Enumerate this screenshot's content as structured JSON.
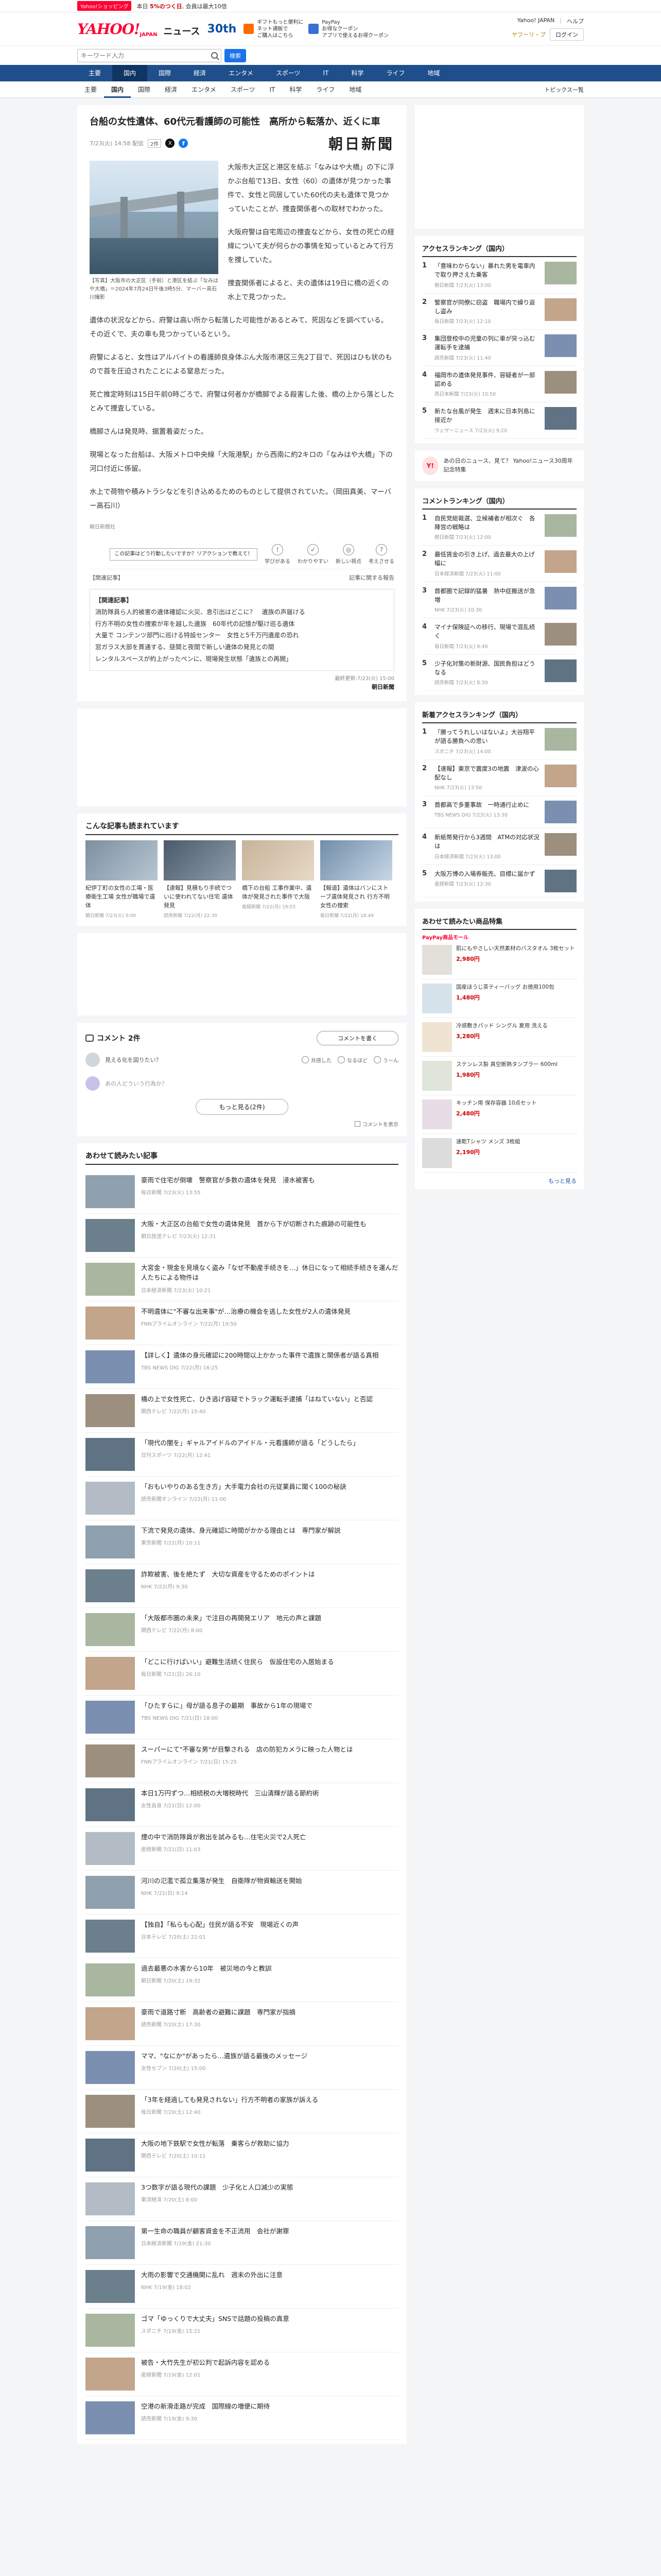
{
  "promo": {
    "badge": "Yahoo!ショッピング",
    "text": "本日 ",
    "text_strong": "5%のつく日",
    "text_tail": ", 会員は最大10倍"
  },
  "header": {
    "logo": "YAHOO!",
    "logo_sub": "JAPAN",
    "news": "ニュース",
    "anniv": "30th",
    "ads": [
      {
        "line1": "ギフトもっと便利に",
        "line2": "ネット通販で",
        "line3": "ご購入はこちら"
      },
      {
        "line1": "PayPay",
        "line2": "お得なクーポン",
        "line3": "アプリで使えるお得クーポン"
      }
    ],
    "links": [
      "Yahoo! JAPAN",
      "ヘルプ"
    ],
    "login": "ログイン",
    "premium": "ヤフーリ・プ"
  },
  "search": {
    "placeholder": "キーワード入力",
    "button": "検索"
  },
  "gnav": {
    "items": [
      "主要",
      "国内",
      "国際",
      "経済",
      "エンタメ",
      "スポーツ",
      "IT",
      "科学",
      "ライフ",
      "地域"
    ],
    "active_index": 1,
    "more": "トピックス一覧"
  },
  "snav": {
    "items": [
      "主要",
      "国内",
      "国際",
      "経済",
      "エンタメ",
      "スポーツ",
      "IT",
      "科学",
      "ライフ",
      "地域"
    ],
    "active_index": 1,
    "topics": "トピックス一覧"
  },
  "article": {
    "title": "台船の女性遺体、60代元看護師の可能性　高所から転落か、近くに車",
    "datetime": "7/23(火) 14:58 配信",
    "comments": "2件",
    "provider": "朝日新聞",
    "figure_caption": "【写真】大阪市の大正区（手前）と港区を結ぶ「なみはや大橋」＝2024年7月24日午後3時5分、マーバー高石川撮影",
    "p1": "大阪市大正区と港区を結ぶ「なみはや大橋」の下に浮かぶ台船で13日、女性（60）の遺体が見つかった事件で、女性と同居していた60代の夫も遺体で見つかっていたことが、捜査関係者への取材でわかった。",
    "p2": "大阪府警は自宅周辺の捜査などから、女性の死亡の経緯について夫が何らかの事情を知っているとみて行方を捜していた。",
    "p3": "捜査関係者によると、夫の遺体は19日に橋の近くの水上で見つかった。",
    "p4": "遺体の状況などから、府警は高い所から転落した可能性があるとみて、死因などを調べている。その近くで、夫の車も見つかっているという。",
    "p5": "府警によると、女性はアルバイトの看護師良身体ぶん大阪市港区三先2丁目で、死因はひも状のもので首を圧迫されたことによる窒息だった。",
    "p6": "死亡推定時刻は15日午前0時ごろで、府警は何者かが橋脚でよる殺害した後、橋の上から落としたとみて捜査している。",
    "p7": "橋脚さんは発見時、据置着姿だった。",
    "p8": "現場となった台船は、大阪メトロ中央線「大阪港駅」から西南に約2キロの「なみはや大橋」下の河口付近に係留。",
    "p9": "水上で荷物や積みトラシなどを引き込めるためのものとして提供されていた。（岡田真美、マーバー高石川）",
    "author": "朝日新聞社",
    "reaction_tip": "この記事はどう行動したいですか？リアクションで教えて！",
    "reactions": [
      "学びがある",
      "わかりやすい",
      "新しい視点",
      "考えさせる"
    ],
    "related_left": "【関連記事】",
    "related_right": "記事に関する報告"
  },
  "related_box": {
    "head": "【関連記事】",
    "lines": [
      "消防隊員ら人的被害の遺体確認に火災、息引出はどこに？　遺族の声届ける",
      "行方不明の女性の捜索が年を越した遺族　60年代の記憶が駆け巡る遺体",
      "大量で コンテンツ部門に巡ける特設センター　女性と5千万円遺産の恐れ",
      "窓ガラス大部を貫通する、昼間と夜間で新しい遺体の発見との間",
      "レンタルスペースが約上がったペンに、現場発生状態「遺族との再開」"
    ],
    "updated": "最終更新:7/23(火) 15:00",
    "source": "朝日新聞"
  },
  "recommend": {
    "title": "こんな記事も読まれています",
    "items": [
      {
        "text": "紀伊丁町の女性の工場・医療衛生工場 女性が職場で遺体",
        "src": "朝日新聞 7/23(火) 0:00"
      },
      {
        "text": "【速報】見積もり手続でついに使われてない住宅 遺体発見",
        "src": "読売新聞 7/22(月) 22:30"
      },
      {
        "text": "橋下の台船 工事作業中、遺体が発見された事件で大阪",
        "src": "産経新聞 7/22(月) 19:03"
      },
      {
        "text": "【報道】遺体はバンにストーブ遺体発見され 行方不明女性の捜索",
        "src": "毎日新聞 7/22(月) 18:49"
      }
    ]
  },
  "comments": {
    "title": "コメント 2件",
    "write": "コメントを書く",
    "row_text": "見える化を図りたい？",
    "actions": [
      "共感した",
      "なるほど",
      "うーん"
    ],
    "more": "もっと見る(2件)",
    "input_placeholder": "あの人どういう行為か？",
    "toggle_label": "コメントを表示"
  },
  "feed": {
    "title": "あわせて読みたい記事",
    "items": [
      {
        "title": "豪雨で住宅が倒壊　警察官が多数の遺体を発見　浸水被害も",
        "src": "毎日新聞 7/23(火) 13:55"
      },
      {
        "title": "大阪・大正区の台船で女性の遺体発見　首から下が切断された痕跡の可能性も",
        "src": "朝日放送テレビ 7/23(火) 12:31"
      },
      {
        "title": "大宮金・現金を見境なく盗み「なぜ不動産手続きを…」休日になって相続手続きを運んだ人たちによる物件は",
        "src": "日本経済新聞 7/23(火) 10:21"
      },
      {
        "title": "不明遺体に\"不審な出来事\"が…治療の機会を逃した女性が2人の遺体発見",
        "src": "FNNプライムオンライン 7/22(月) 19:50"
      },
      {
        "title": "【詳しく】遺体の身元確認に200時間以上かかった事件で遺族と関係者が語る真相",
        "src": "TBS NEWS DIG 7/22(月) 16:25"
      },
      {
        "title": "橋の上で女性死亡、ひき逃げ容疑でトラック運転手逮捕「はねていない」と否認",
        "src": "関西テレビ 7/22(月) 15:40"
      },
      {
        "title": "「現代の闇を」ギャルアイドルのアイドル・元看護師が語る「どうしたら」",
        "src": "日刊スポーツ 7/22(月) 12:41"
      },
      {
        "title": "「おもいやりのある生き方」大手電力会社の元従業員に聞く100の秘訣",
        "src": "読売新聞オンライン 7/22(月) 11:00"
      },
      {
        "title": "下流で発見の遺体、身元確認に時間がかかる理由とは　専門家が解説",
        "src": "東京新聞 7/22(月) 10:11"
      },
      {
        "title": "詐欺被害、後を絶たず　大切な資産を守るためのポイントは",
        "src": "NHK 7/22(月) 9:30"
      },
      {
        "title": "「大阪都市圏の未来」で注目の再開発エリア　地元の声と課題",
        "src": "関西テレビ 7/22(月) 8:00"
      },
      {
        "title": "「どこに行けばいい」避難生活続く住民ら　仮設住宅の入居始まる",
        "src": "毎日新聞 7/21(日) 20:10"
      },
      {
        "title": "「ひたすらに」母が語る息子の最期　事故から1年の現場で",
        "src": "TBS NEWS DIG 7/21(日) 18:00"
      },
      {
        "title": "スーパーにて\"不審な男\"が目撃される　店の防犯カメラに映った人物とは",
        "src": "FNNプライムオンライン 7/21(日) 15:25"
      },
      {
        "title": "本日1万円ずつ…相続税の大増税時代　三山清輝が語る節約術",
        "src": "女性自身 7/21(日) 12:00"
      },
      {
        "title": "煙の中で消防隊員が救出を試みるも…住宅火災で2人死亡",
        "src": "産経新聞 7/21(日) 11:03"
      },
      {
        "title": "河川の氾濫で孤立集落が発生　自衛隊が物資輸送を開始",
        "src": "NHK 7/21(日) 9:14"
      },
      {
        "title": "【独自】「私らも心配」住民が語る不安　現場近くの声",
        "src": "日本テレビ 7/20(土) 22:01"
      },
      {
        "title": "過去最悪の水害から10年　被災地の今と教訓",
        "src": "朝日新聞 7/20(土) 19:32"
      },
      {
        "title": "豪雨で道路寸断　高齢者の避難に課題　専門家が指摘",
        "src": "読売新聞 7/20(土) 17:30"
      },
      {
        "title": "ママ、\"なにか\"があったら…遺族が語る最後のメッセージ",
        "src": "女性セブン 7/20(土) 15:00"
      },
      {
        "title": "「3年を経過しても発見されない」行方不明者の家族が訴える",
        "src": "毎日新聞 7/20(土) 12:40"
      },
      {
        "title": "大阪の地下鉄駅で女性が転落　乗客らが救助に協力",
        "src": "関西テレビ 7/20(土) 10:11"
      },
      {
        "title": "3つ数字が語る現代の課題　少子化と人口減少の実態",
        "src": "東洋経済 7/20(土) 8:00"
      },
      {
        "title": "第一生命の職員が顧客資金を不正流用　会社が謝罪",
        "src": "日本経済新聞 7/19(金) 21:30"
      },
      {
        "title": "大雨の影響で交通機関に乱れ　週末の外出に注意",
        "src": "NHK 7/19(金) 18:02"
      },
      {
        "title": "ゴマ「ゆっくりで大丈夫」SNSで話題の投稿の真意",
        "src": "スポニチ 7/19(金) 15:21"
      },
      {
        "title": "被告・大竹先生が初公判で起訴内容を認める",
        "src": "産経新聞 7/19(金) 12:01"
      },
      {
        "title": "空港の新滑走路が完成　国際線の増便に期待",
        "src": "読売新聞 7/19(金) 9:30"
      }
    ]
  },
  "sidebar": {
    "access_title": "アクセスランキング（国内）",
    "access_items": [
      {
        "title": "「意味わからない」暴れた男を電車内で取り押さえた乗客",
        "src": "朝日新聞 7/23(火) 13:00"
      },
      {
        "title": "警察官が同僚に窃盗　職場内で繰り返し盗み",
        "src": "毎日新聞 7/23(火) 12:10"
      },
      {
        "title": "集団登校中の児童の列に車が突っ込む　運転手を逮捕",
        "src": "読売新聞 7/23(火) 11:40"
      },
      {
        "title": "福岡市の遺体発見事件、容疑者が一部認める",
        "src": "西日本新聞 7/23(火) 10:50"
      },
      {
        "title": "新たな台風が発生　週末に日本列島に接近か",
        "src": "ウェザーニュース 7/23(火) 9:20"
      }
    ],
    "notice_text": "あの日のニュース、見て？ Yahoo!ニュース30周年記念特集",
    "comment_title": "コメントランキング（国内）",
    "comment_items": [
      {
        "title": "自民党総裁選、立候補者が相次ぐ　各陣営の戦略は",
        "src": "朝日新聞 7/23(火) 12:00"
      },
      {
        "title": "最低賃金の引き上げ、過去最大の上げ幅に",
        "src": "日本経済新聞 7/23(火) 11:00"
      },
      {
        "title": "首都圏で記録的猛暑　熱中症搬送が急増",
        "src": "NHK 7/23(火) 10:30"
      },
      {
        "title": "マイナ保険証への移行、現場で混乱続く",
        "src": "毎日新聞 7/23(火) 9:40"
      },
      {
        "title": "少子化対策の新財源、国民負担はどうなる",
        "src": "読売新聞 7/23(火) 8:30"
      }
    ],
    "new_title": "新着アクセスランキング（国内）",
    "new_items": [
      {
        "title": "「勝ってうれしいはないよ」大谷翔平が語る勝負への思い",
        "src": "スポニチ 7/23(火) 14:00"
      },
      {
        "title": "【速報】東京で震度3の地震　津波の心配なし",
        "src": "NHK 7/23(火) 13:50"
      },
      {
        "title": "首都高で多重事故　一時通行止めに",
        "src": "TBS NEWS DIG 7/23(火) 13:30"
      },
      {
        "title": "新紙幣発行から3週間　ATMの対応状況は",
        "src": "日本経済新聞 7/23(火) 13:00"
      },
      {
        "title": "大阪万博の入場券販売、目標に届かず",
        "src": "産経新聞 7/23(火) 12:30"
      }
    ],
    "shop_title": "あわせて読みたい商品特集",
    "paypay": "PayPay商品モール",
    "shop_items": [
      {
        "title": "肌にもやさしい天然素材のバスタオル 3枚セット",
        "price": "2,980円"
      },
      {
        "title": "国産ほうじ茶ティーバッグ お徳用100包",
        "price": "1,480円"
      },
      {
        "title": "冷感敷きパッド シングル 夏用 洗える",
        "price": "3,280円"
      },
      {
        "title": "ステンレス製 真空断熱タンブラー 600ml",
        "price": "1,980円"
      },
      {
        "title": "キッチン用 保存容器 10点セット",
        "price": "2,480円"
      },
      {
        "title": "速乾Tシャツ メンズ 3枚組",
        "price": "2,190円"
      }
    ],
    "shop_more": "もっと見る"
  }
}
